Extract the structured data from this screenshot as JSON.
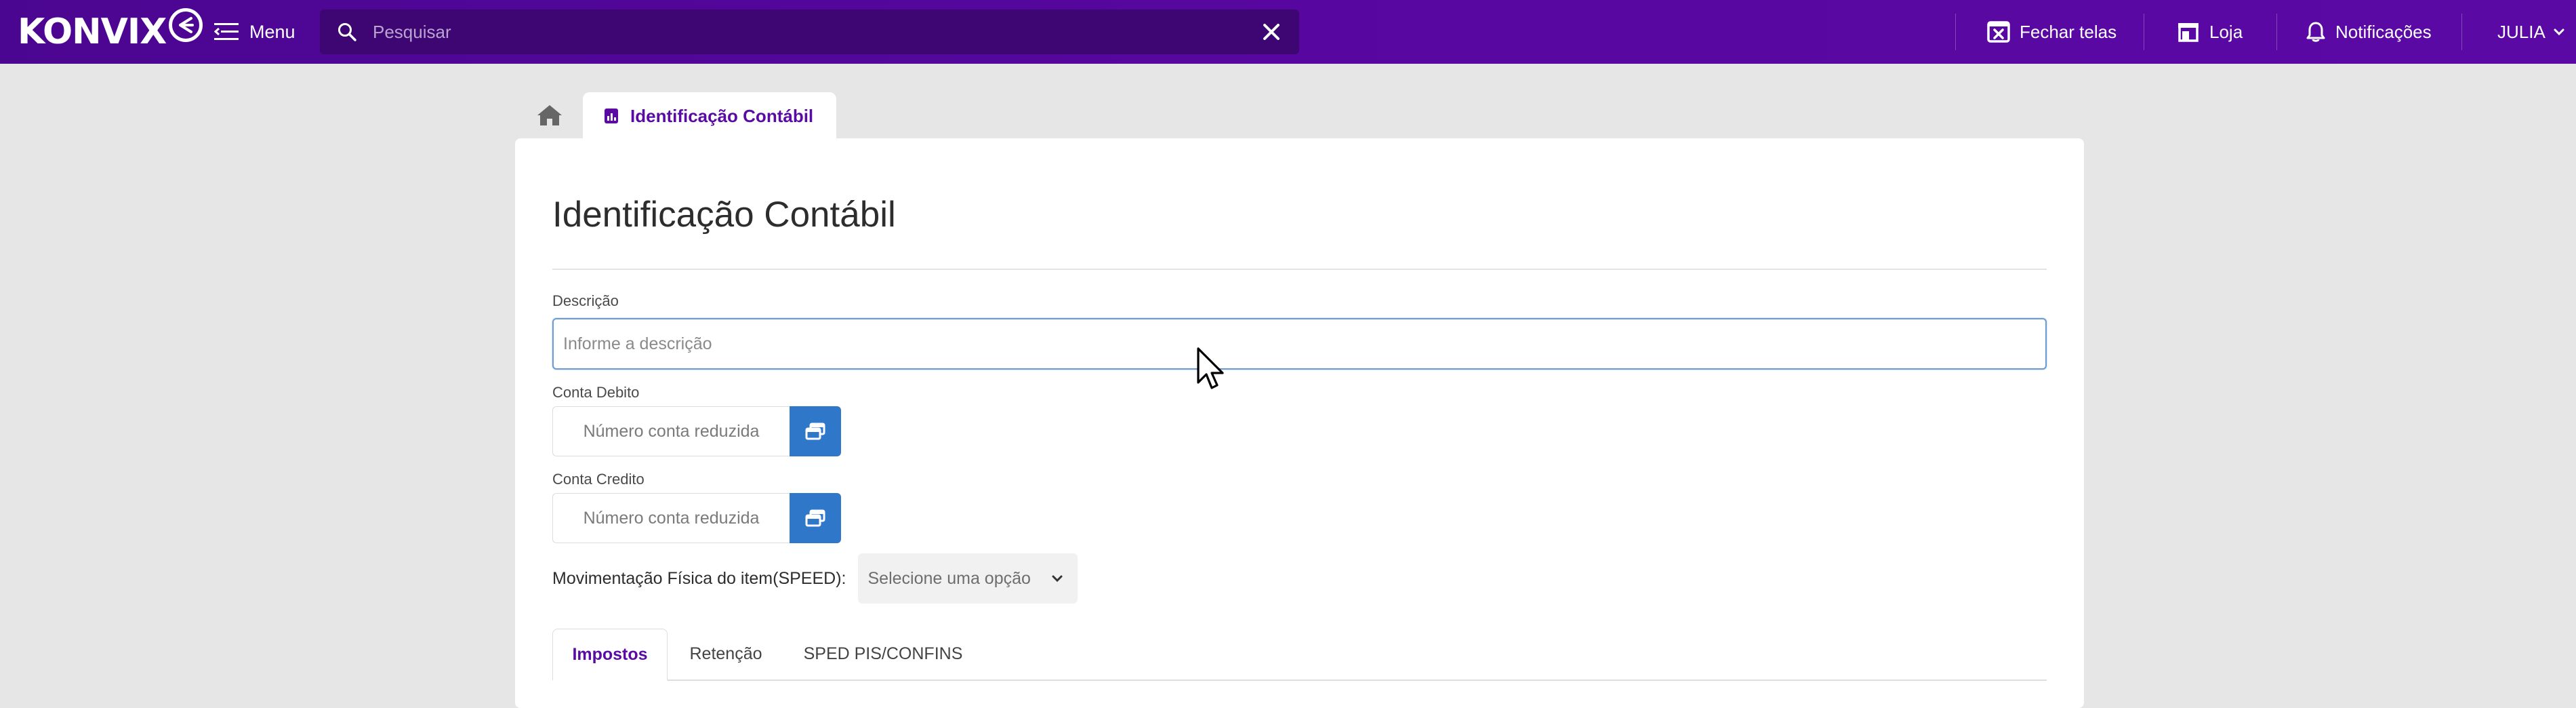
{
  "topbar": {
    "logo_text": "KONVIX",
    "menu_label": "Menu",
    "search_placeholder": "Pesquisar",
    "close_screens_label": "Fechar telas",
    "store_label": "Loja",
    "notifications_label": "Notificações",
    "user_label": "JULIA"
  },
  "tabs_bar": {
    "active_tab_label": "Identificação Contábil"
  },
  "form": {
    "title": "Identificação Contábil",
    "description_label": "Descrição",
    "description_placeholder": "Informe a descrição",
    "description_value": "",
    "debit_label": "Conta Debito",
    "debit_placeholder": "Número conta reduzida",
    "credit_label": "Conta Credito",
    "credit_placeholder": "Número conta reduzida",
    "speed_label": "Movimentação Física do item(SPEED):",
    "speed_selected": "Selecione uma opção"
  },
  "section_tabs": [
    {
      "label": "Impostos",
      "active": true
    },
    {
      "label": "Retenção",
      "active": false
    },
    {
      "label": "SPED PIS/CONFINS",
      "active": false
    }
  ],
  "colors": {
    "topbar": "#56079e",
    "accent": "#5a0ba3",
    "primary_button": "#2f77c9",
    "background": "#e6e6e6"
  }
}
